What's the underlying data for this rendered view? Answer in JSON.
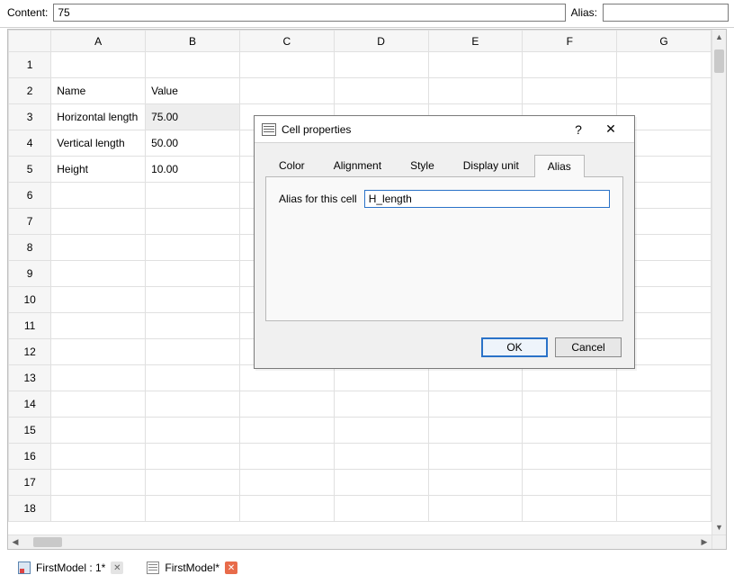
{
  "topbar": {
    "content_label": "Content:",
    "content_value": "75",
    "alias_label": "Alias:",
    "alias_value": ""
  },
  "sheet": {
    "columns": [
      "A",
      "B",
      "C",
      "D",
      "E",
      "F",
      "G"
    ],
    "row_count": 18,
    "cells": {
      "A2": "Name",
      "B2": "Value",
      "A3": "Horizontal length",
      "B3": "75.00",
      "A4": "Vertical length",
      "B4": "50.00",
      "A5": "Height",
      "B5": "10.00"
    },
    "selected_cell": "B3"
  },
  "dialog": {
    "title": "Cell properties",
    "tabs": [
      "Color",
      "Alignment",
      "Style",
      "Display unit",
      "Alias"
    ],
    "active_tab": 4,
    "alias_field_label": "Alias for this cell",
    "alias_field_value": "H_length",
    "ok": "OK",
    "cancel": "Cancel"
  },
  "doctabs": {
    "items": [
      {
        "label": "FirstModel : 1*",
        "active": false,
        "close_style": "grey"
      },
      {
        "label": "FirstModel*",
        "active": true,
        "close_style": "red"
      }
    ]
  }
}
